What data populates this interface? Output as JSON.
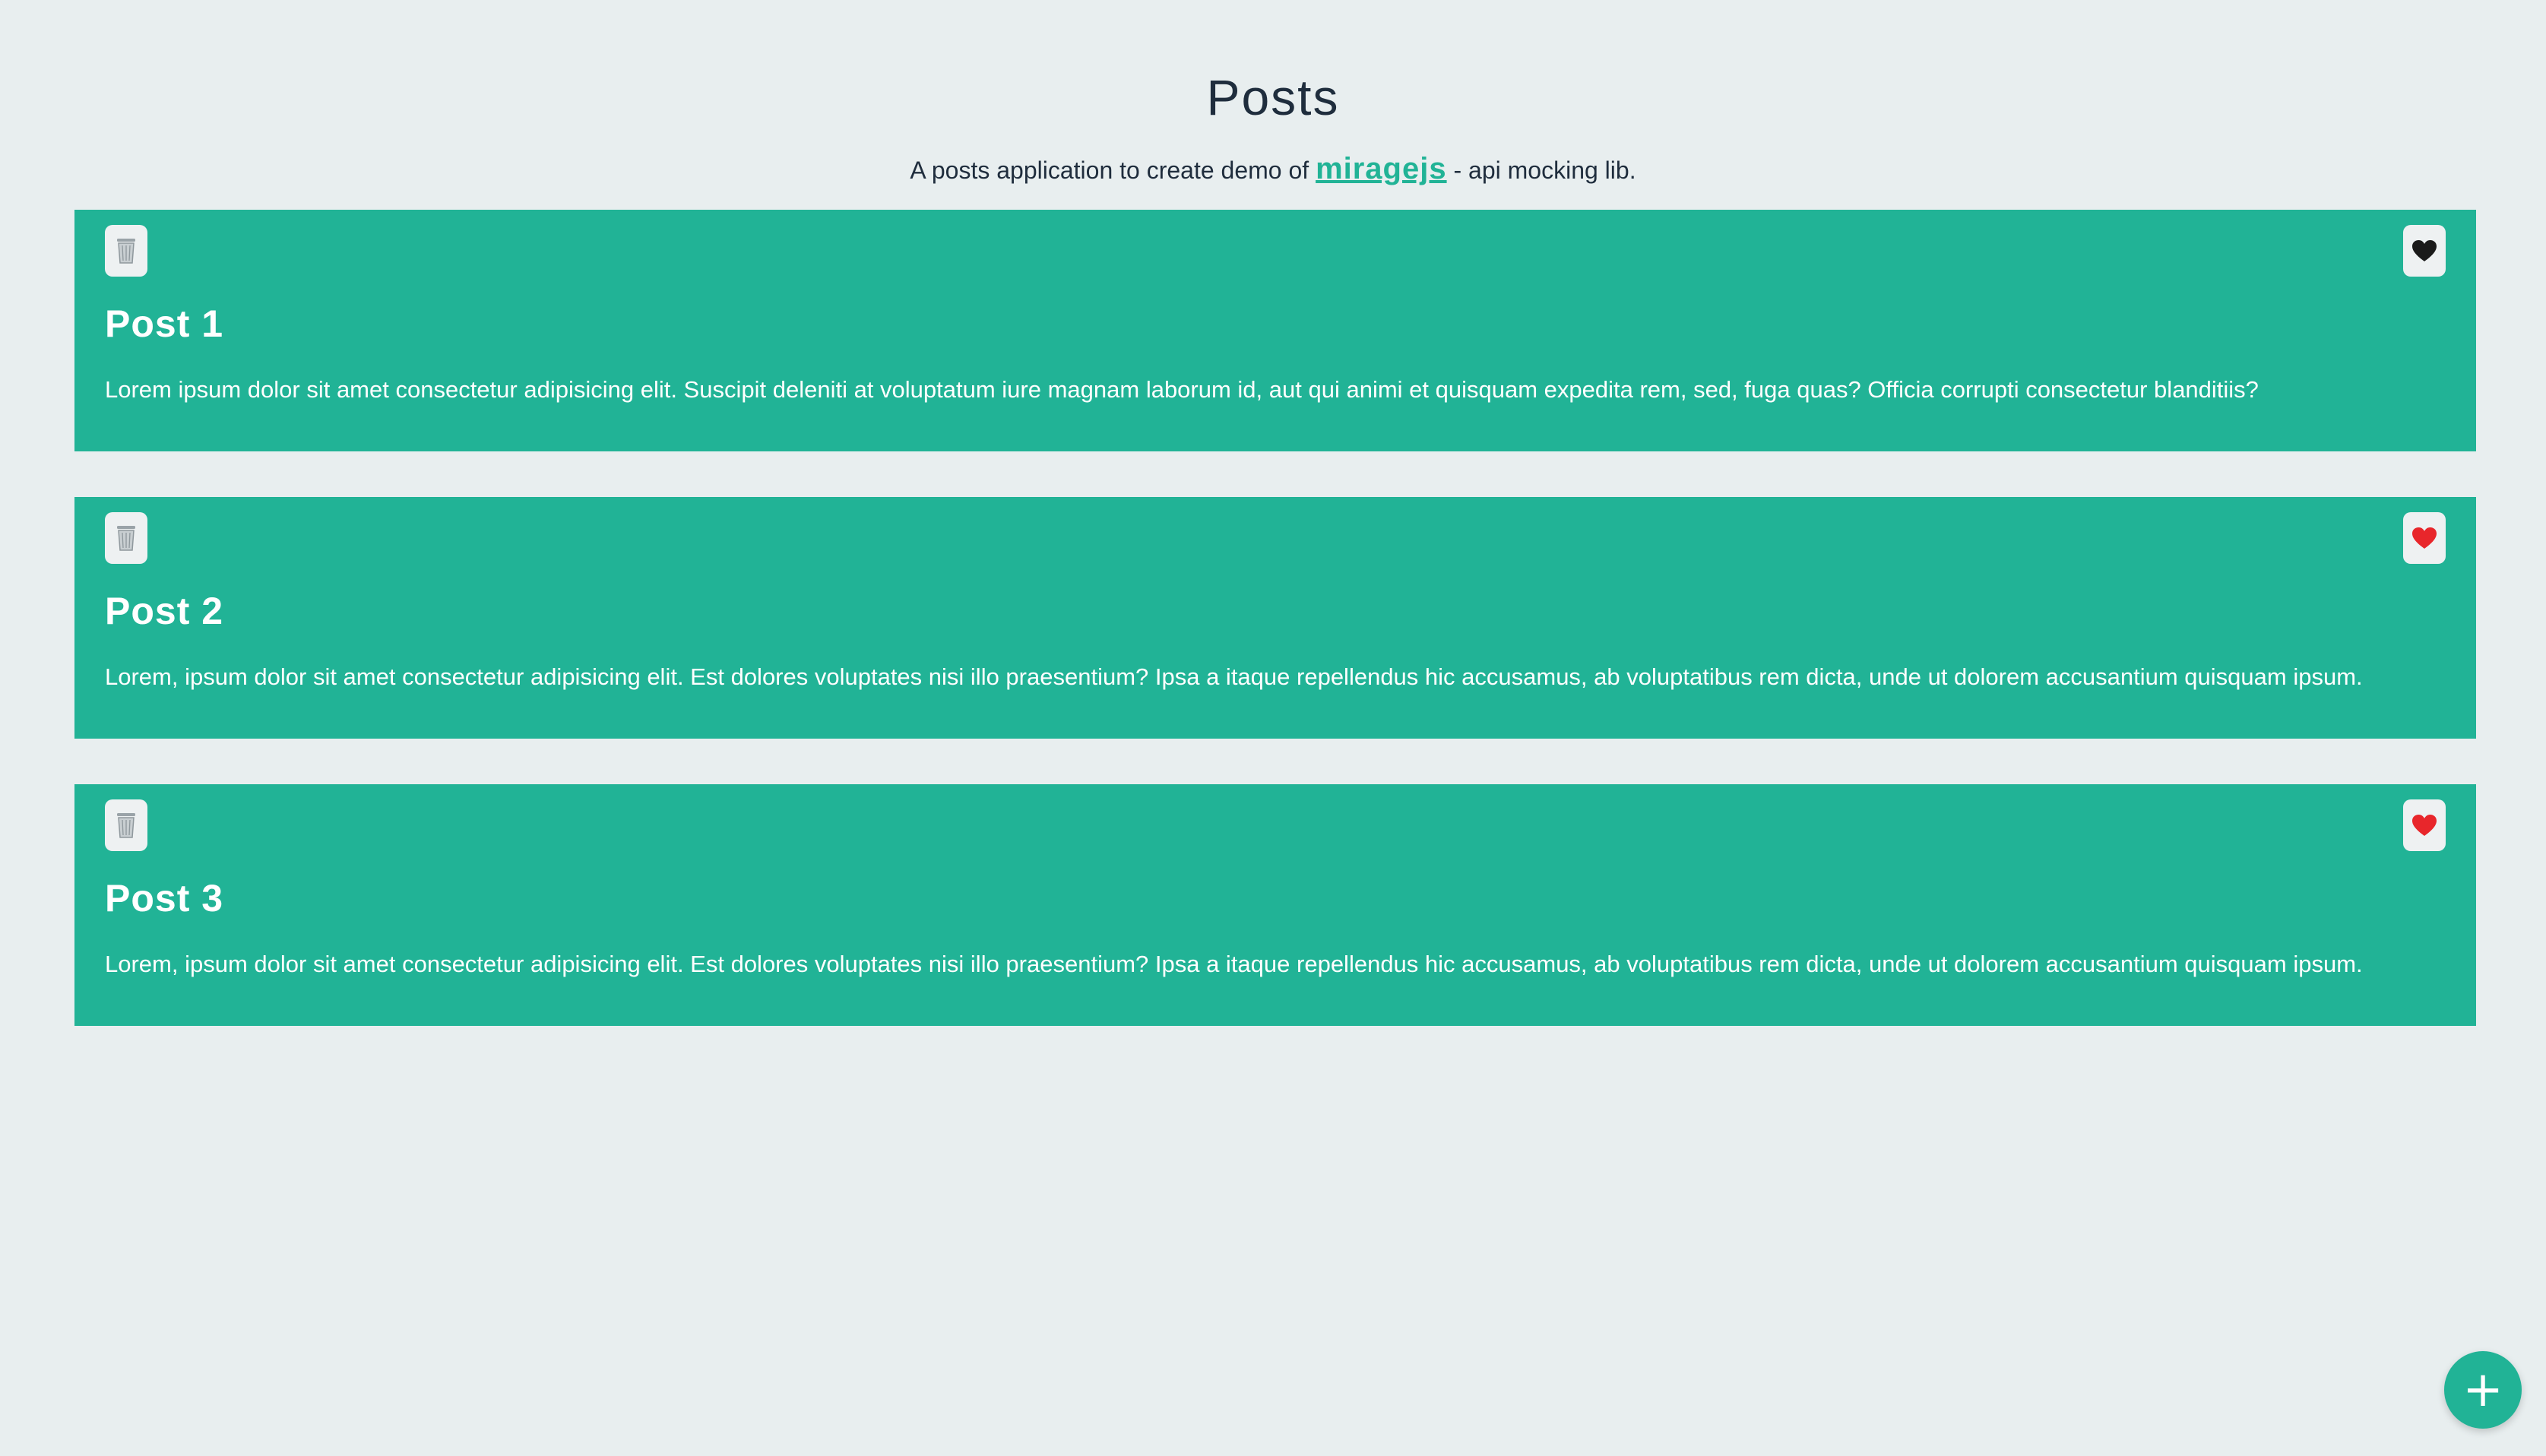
{
  "header": {
    "title": "Posts",
    "subtitle_before": "A posts application to create demo of ",
    "subtitle_link": "miragejs",
    "subtitle_after": " - api mocking lib."
  },
  "posts": [
    {
      "title": "Post 1",
      "body": "Lorem ipsum dolor sit amet consectetur adipisicing elit. Suscipit deleniti at voluptatum iure magnam laborum id, aut qui animi et quisquam expedita rem, sed, fuga quas? Officia corrupti consectetur blanditiis?",
      "liked": false,
      "delete_icon": "trash-can-icon",
      "like_icon": "black-heart-icon"
    },
    {
      "title": "Post 2",
      "body": "Lorem, ipsum dolor sit amet consectetur adipisicing elit. Est dolores voluptates nisi illo praesentium? Ipsa a itaque repellendus hic accusamus, ab voluptatibus rem dicta, unde ut dolorem accusantium quisquam ipsum.",
      "liked": true,
      "delete_icon": "trash-can-icon",
      "like_icon": "red-heart-icon"
    },
    {
      "title": "Post 3",
      "body": "Lorem, ipsum dolor sit amet consectetur adipisicing elit. Est dolores voluptates nisi illo praesentium? Ipsa a itaque repellendus hic accusamus, ab voluptatibus rem dicta, unde ut dolorem accusantium quisquam ipsum.",
      "liked": true,
      "delete_icon": "trash-can-icon",
      "like_icon": "red-heart-icon"
    }
  ],
  "fab": {
    "label": "+",
    "icon": "plus-icon"
  },
  "colors": {
    "accent": "#21b396",
    "background": "#e8eeef",
    "heart_liked": "#e8262b",
    "heart_unliked": "#1a1a1a"
  }
}
